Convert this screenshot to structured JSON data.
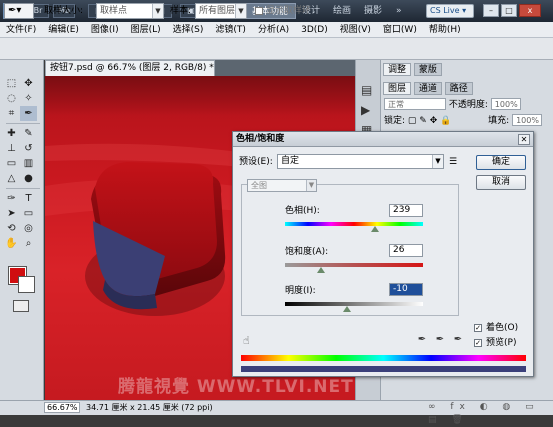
{
  "titlebar": {
    "app_logo": "Ps",
    "workspaces": {
      "active": "基本功能",
      "items": [
        "设计",
        "绘画",
        "摄影"
      ],
      "more": "»"
    },
    "cs_live": "CS Live ▾",
    "window_buttons": [
      "–",
      "□",
      "x"
    ]
  },
  "menubar": {
    "items": [
      "文件(F)",
      "编辑(E)",
      "图像(I)",
      "图层(L)",
      "选择(S)",
      "滤镜(T)",
      "分析(A)",
      "3D(D)",
      "视图(V)",
      "窗口(W)",
      "帮助(H)"
    ]
  },
  "options": {
    "sample_size_label": "取样大小:",
    "sample_size_value": "取样点",
    "sample_label": "样本:",
    "sample_value": "所有图层",
    "show_ring_label": "显示取样环"
  },
  "document": {
    "tab_title": "按钮7.psd @ 66.7% (图层 2, RGB/8) *",
    "zoom": "66.67%",
    "doc_size": "34.71 厘米 x 21.45 厘米 (72 ppi)"
  },
  "right_panel": {
    "tabs_top": [
      "调整",
      "蒙版"
    ],
    "tabs_layers": [
      "图层",
      "通道",
      "路径"
    ],
    "blend_mode": "正常",
    "opacity_label": "不透明度:",
    "opacity_value": "100%",
    "lock_label": "锁定:",
    "fill_label": "填充:",
    "fill_value": "100%"
  },
  "colors": {
    "foreground": "#d00e10",
    "background": "#ffffff"
  },
  "dialog": {
    "title": "色相/饱和度",
    "preset_label": "预设(E):",
    "preset_value": "自定",
    "ok_label": "确定",
    "cancel_label": "取消",
    "channel_value": "全图",
    "hue_label": "色相(H):",
    "hue_value": "239",
    "saturation_label": "饱和度(A):",
    "saturation_value": "26",
    "lightness_label": "明度(I):",
    "lightness_value": "-10",
    "colorize_label": "着色(O)",
    "colorize_checked": true,
    "preview_label": "预览(P)",
    "preview_checked": true
  },
  "watermark": "腾龍視覺 WWW.TLVI.NET"
}
